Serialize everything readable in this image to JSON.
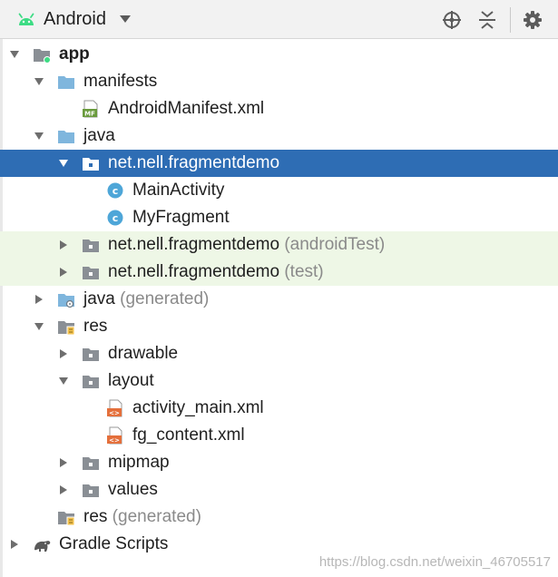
{
  "toolbar": {
    "view_label": "Android",
    "icons": [
      "android-icon",
      "dropdown-caret-icon",
      "locate-icon",
      "collapse-all-icon",
      "gear-icon"
    ]
  },
  "tree": [
    {
      "label": "app",
      "suffix": "",
      "depth": 0,
      "arrow": "down",
      "icon": "module-folder-icon",
      "bold": true,
      "state": "normal"
    },
    {
      "label": "manifests",
      "suffix": "",
      "depth": 1,
      "arrow": "down",
      "icon": "folder-icon",
      "bold": false,
      "state": "normal"
    },
    {
      "label": "AndroidManifest.xml",
      "suffix": "",
      "depth": 2,
      "arrow": "none",
      "icon": "manifest-file-icon",
      "bold": false,
      "state": "normal"
    },
    {
      "label": "java",
      "suffix": "",
      "depth": 1,
      "arrow": "down",
      "icon": "folder-icon",
      "bold": false,
      "state": "normal"
    },
    {
      "label": "net.nell.fragmentdemo",
      "suffix": "",
      "depth": 2,
      "arrow": "down",
      "icon": "package-icon",
      "bold": false,
      "state": "selected"
    },
    {
      "label": "MainActivity",
      "suffix": "",
      "depth": 3,
      "arrow": "none",
      "icon": "class-icon",
      "bold": false,
      "state": "normal"
    },
    {
      "label": "MyFragment",
      "suffix": "",
      "depth": 3,
      "arrow": "none",
      "icon": "class-icon",
      "bold": false,
      "state": "normal"
    },
    {
      "label": "net.nell.fragmentdemo",
      "suffix": " (androidTest)",
      "depth": 2,
      "arrow": "right",
      "icon": "package-icon",
      "bold": false,
      "state": "test"
    },
    {
      "label": "net.nell.fragmentdemo",
      "suffix": " (test)",
      "depth": 2,
      "arrow": "right",
      "icon": "package-icon",
      "bold": false,
      "state": "test"
    },
    {
      "label": "java",
      "suffix": " (generated)",
      "depth": 1,
      "arrow": "right",
      "icon": "generated-folder-icon",
      "bold": false,
      "state": "normal"
    },
    {
      "label": "res",
      "suffix": "",
      "depth": 1,
      "arrow": "down",
      "icon": "res-folder-icon",
      "bold": false,
      "state": "normal"
    },
    {
      "label": "drawable",
      "suffix": "",
      "depth": 2,
      "arrow": "right",
      "icon": "package-icon",
      "bold": false,
      "state": "normal"
    },
    {
      "label": "layout",
      "suffix": "",
      "depth": 2,
      "arrow": "down",
      "icon": "package-icon",
      "bold": false,
      "state": "normal"
    },
    {
      "label": "activity_main.xml",
      "suffix": "",
      "depth": 3,
      "arrow": "none",
      "icon": "layout-file-icon",
      "bold": false,
      "state": "normal"
    },
    {
      "label": "fg_content.xml",
      "suffix": "",
      "depth": 3,
      "arrow": "none",
      "icon": "layout-file-icon",
      "bold": false,
      "state": "normal"
    },
    {
      "label": "mipmap",
      "suffix": "",
      "depth": 2,
      "arrow": "right",
      "icon": "package-icon",
      "bold": false,
      "state": "normal"
    },
    {
      "label": "values",
      "suffix": "",
      "depth": 2,
      "arrow": "right",
      "icon": "package-icon",
      "bold": false,
      "state": "normal"
    },
    {
      "label": "res",
      "suffix": " (generated)",
      "depth": 1,
      "arrow": "none",
      "icon": "res-folder-icon",
      "bold": false,
      "state": "normal"
    },
    {
      "label": "Gradle Scripts",
      "suffix": "",
      "depth": 0,
      "arrow": "right",
      "icon": "gradle-icon",
      "bold": false,
      "state": "normal"
    }
  ],
  "watermark": "https://blog.csdn.net/weixin_46705517",
  "colors": {
    "selection": "#2e6db4",
    "test_row": "#eef7e6",
    "folder": "#7fb6dd",
    "package": "#8a8f95",
    "class_badge": "#4ea6d8",
    "android_green": "#3ddc84",
    "layout_orange": "#e46f3b"
  }
}
